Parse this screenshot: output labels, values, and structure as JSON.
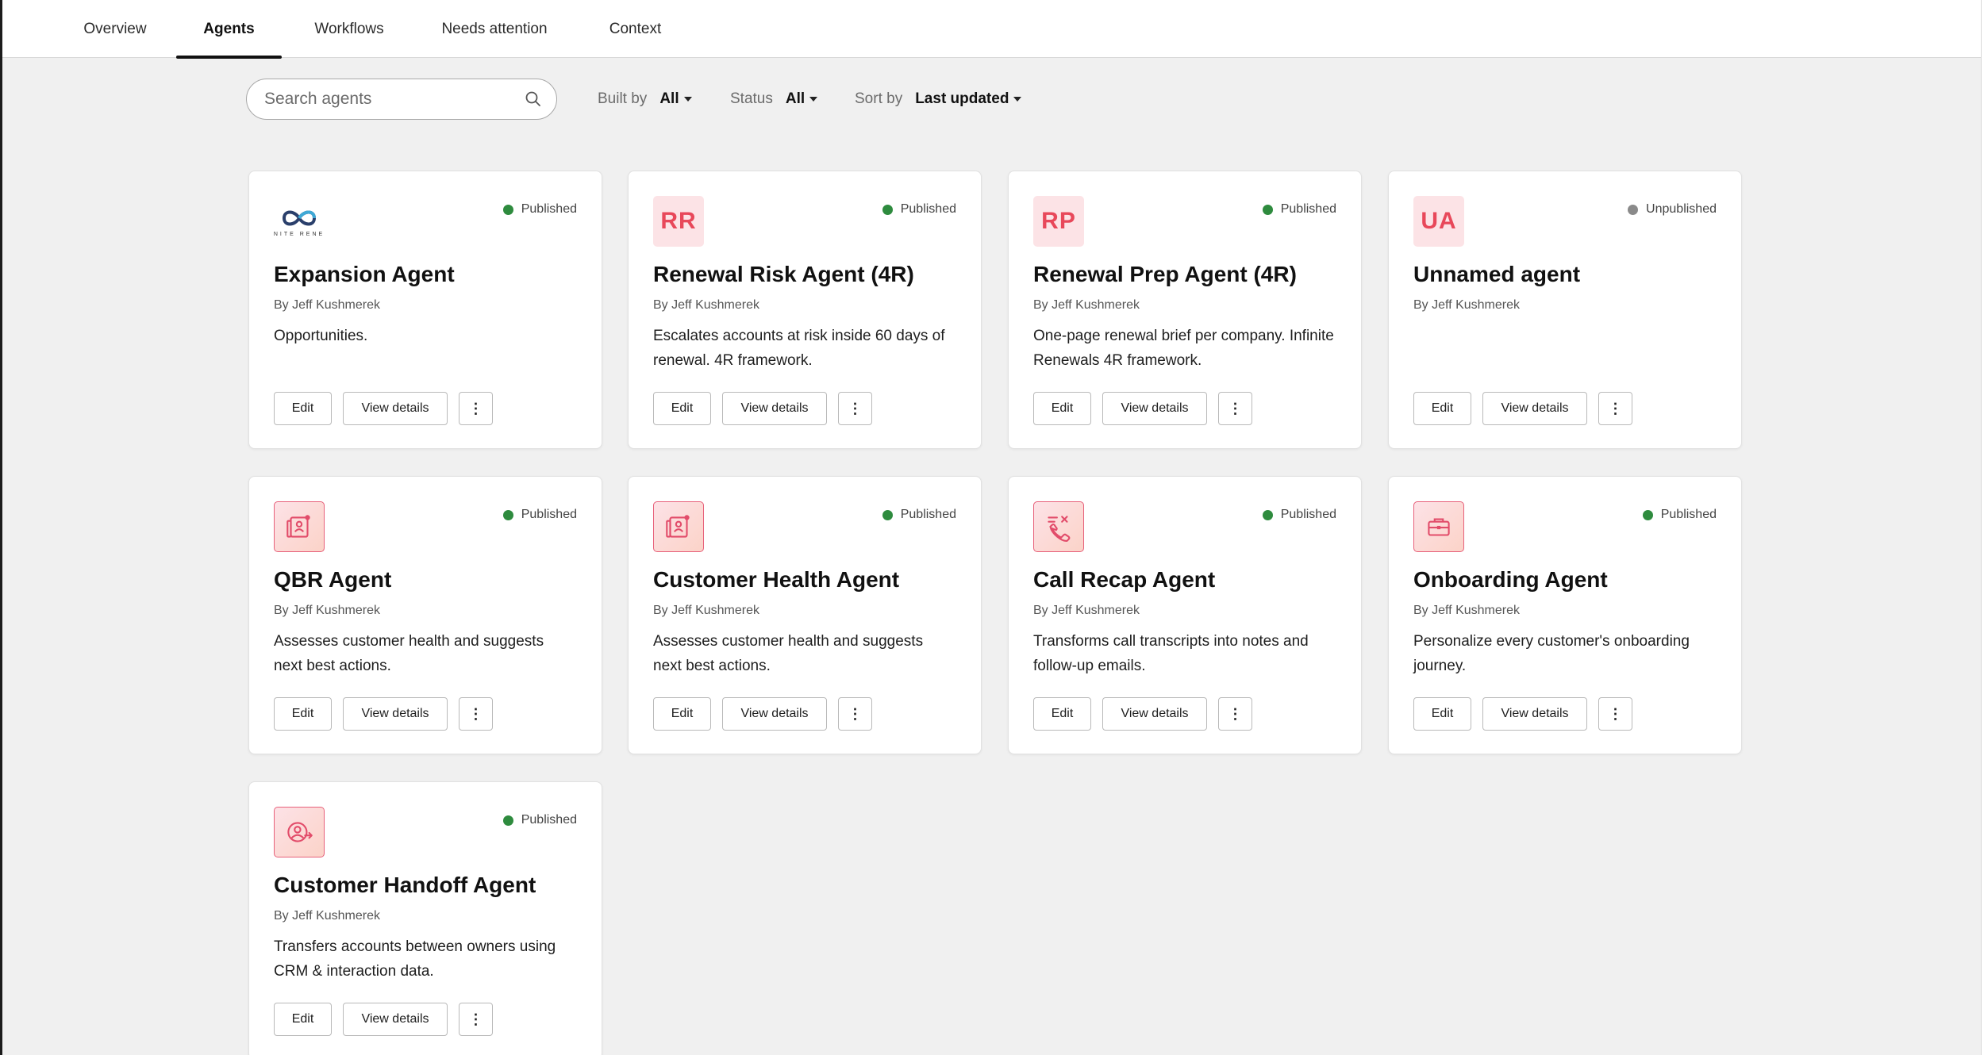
{
  "nav": {
    "tabs": [
      {
        "label": "Overview",
        "active": false
      },
      {
        "label": "Agents",
        "active": true
      },
      {
        "label": "Workflows",
        "active": false
      },
      {
        "label": "Needs attention",
        "active": false
      },
      {
        "label": "Context",
        "active": false
      }
    ]
  },
  "toolbar": {
    "search_placeholder": "Search agents",
    "search_icon": "search-icon",
    "filters": [
      {
        "label": "Built by",
        "value": "All"
      },
      {
        "label": "Status",
        "value": "All"
      },
      {
        "label": "Sort by",
        "value": "Last updated"
      }
    ]
  },
  "colors": {
    "published": "#2e8b3e",
    "unpublished": "#8a8a8a",
    "initials_bg": "#fce3e6",
    "initials_fg": "#e8485a",
    "icon_accent": "#e24c6a"
  },
  "agents": [
    {
      "title": "Expansion Agent",
      "author": "By Jeff Kushmerek",
      "description": "Opportunities.",
      "status": "Published",
      "icon_type": "logo",
      "icon": "infinity-logo-icon",
      "logo_text": "NITE RENE",
      "initials": ""
    },
    {
      "title": "Renewal Risk Agent (4R)",
      "author": "By Jeff Kushmerek",
      "description": "Escalates accounts at risk inside 60 days of renewal. 4R framework.",
      "status": "Published",
      "icon_type": "initials",
      "icon": "",
      "logo_text": "",
      "initials": "RR"
    },
    {
      "title": "Renewal Prep Agent (4R)",
      "author": "By Jeff Kushmerek",
      "description": "One-page renewal brief per company. Infinite Renewals 4R framework.",
      "status": "Published",
      "icon_type": "initials",
      "icon": "",
      "logo_text": "",
      "initials": "RP"
    },
    {
      "title": "Unnamed agent",
      "author": "By Jeff Kushmerek",
      "description": "",
      "status": "Unpublished",
      "icon_type": "initials",
      "icon": "",
      "logo_text": "",
      "initials": "UA"
    },
    {
      "title": "QBR Agent",
      "author": "By Jeff Kushmerek",
      "description": "Assesses customer health and suggests next best actions.",
      "status": "Published",
      "icon_type": "graphic",
      "icon": "contact-report-icon",
      "logo_text": "",
      "initials": ""
    },
    {
      "title": "Customer Health Agent",
      "author": "By Jeff Kushmerek",
      "description": "Assesses customer health and suggests next best actions.",
      "status": "Published",
      "icon_type": "graphic",
      "icon": "contact-report-icon",
      "logo_text": "",
      "initials": ""
    },
    {
      "title": "Call Recap Agent",
      "author": "By Jeff Kushmerek",
      "description": "Transforms call transcripts into notes and follow-up emails.",
      "status": "Published",
      "icon_type": "graphic",
      "icon": "phone-call-icon",
      "logo_text": "",
      "initials": ""
    },
    {
      "title": "Onboarding Agent",
      "author": "By Jeff Kushmerek",
      "description": "Personalize every customer's onboarding journey.",
      "status": "Published",
      "icon_type": "graphic",
      "icon": "briefcase-icon",
      "logo_text": "",
      "initials": ""
    },
    {
      "title": "Customer Handoff Agent",
      "author": "By Jeff Kushmerek",
      "description": "Transfers accounts between owners using CRM & interaction data.",
      "status": "Published",
      "icon_type": "graphic",
      "icon": "user-transfer-icon",
      "logo_text": "",
      "initials": ""
    }
  ],
  "card_actions": {
    "edit_label": "Edit",
    "view_label": "View details",
    "more_label": "⋮"
  }
}
